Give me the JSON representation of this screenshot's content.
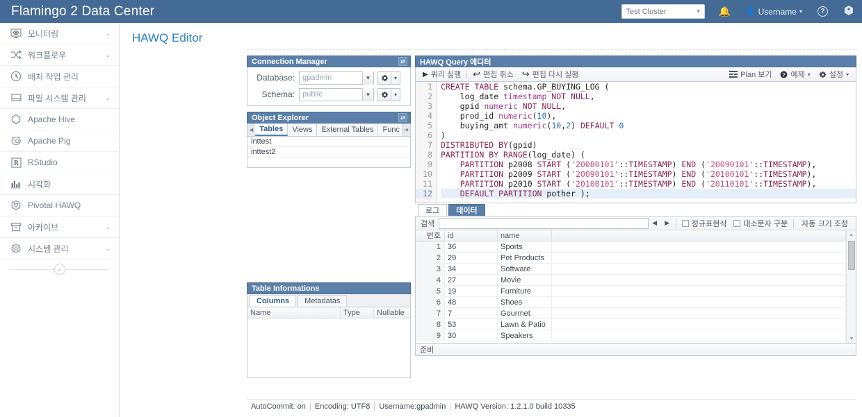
{
  "header": {
    "brand": "Flamingo 2 Data Center",
    "cluster_value": "Test Cluster",
    "notifications_icon": "bell-icon",
    "username": "Username",
    "help_icon": "question-icon",
    "package_icon": "cube-icon"
  },
  "sidebar": {
    "items": [
      {
        "label": "모니터링",
        "icon": "monitor-eye-icon",
        "chevron": "⌄"
      },
      {
        "label": "워크플로우",
        "icon": "workflow-icon",
        "chevron": "⌄"
      },
      {
        "label": "배치 작업 관리",
        "icon": "clock-icon",
        "chevron": ""
      },
      {
        "label": "파일 시스템 관리",
        "icon": "drive-icon",
        "chevron": "⌄"
      },
      {
        "label": "Apache Hive",
        "icon": "hexagon-icon",
        "chevron": ""
      },
      {
        "label": "Apache Pig",
        "icon": "pig-icon",
        "chevron": ""
      },
      {
        "label": "RStudio",
        "icon": "r-box-icon",
        "chevron": ""
      },
      {
        "label": "시각화",
        "icon": "bar-chart-icon",
        "chevron": ""
      },
      {
        "label": "Pivotal HAWQ",
        "icon": "hawq-cube-icon",
        "chevron": ""
      },
      {
        "label": "아카이브",
        "icon": "archive-box-icon",
        "chevron": "⌄"
      },
      {
        "label": "시스템 관리",
        "icon": "gear-icon",
        "chevron": "⌄"
      }
    ],
    "collapse_label": "«"
  },
  "page": {
    "title": "HAWQ Editor"
  },
  "connection_manager": {
    "title": "Connection Manager",
    "restore_icon": "restore-icon",
    "fields": [
      {
        "label": "Database:",
        "value": "gpadmin",
        "gear_icon": "gear-icon",
        "caret": "▾"
      },
      {
        "label": "Schema:",
        "value": "public",
        "gear_icon": "gear-icon",
        "caret": "▾"
      }
    ]
  },
  "object_explorer": {
    "title": "Object Explorer",
    "restore_icon": "restore-icon",
    "scroll_left": "◄",
    "scroll_right": "➜",
    "tabs": [
      {
        "label": "Tables",
        "active": true
      },
      {
        "label": "Views",
        "active": false
      },
      {
        "label": "External Tables",
        "active": false
      },
      {
        "label": "Func",
        "active": false
      }
    ],
    "rows": [
      "inttest",
      "inttest2"
    ]
  },
  "table_informations": {
    "title": "Table Informations",
    "tabs": [
      {
        "label": "Columns",
        "active": true
      },
      {
        "label": "Metadatas",
        "active": false
      }
    ],
    "columns": [
      "Name",
      "Type",
      "Nullable"
    ],
    "rows": []
  },
  "query_editor": {
    "title": "HAWQ Query 에디터",
    "toolbar_left": [
      {
        "label": "쿼리 실행",
        "icon": "play-icon"
      },
      {
        "label": "편집 취소",
        "icon": "undo-arrow-icon"
      },
      {
        "label": "편집 다시 실행",
        "icon": "redo-arrow-icon"
      }
    ],
    "toolbar_right": [
      {
        "label": "Plan 보기",
        "icon": "plan-list-icon",
        "caret": ""
      },
      {
        "label": "예제",
        "icon": "question-circle-icon",
        "caret": "▾"
      },
      {
        "label": "설정",
        "icon": "gear-icon",
        "caret": "▾"
      }
    ],
    "line_numbers": [
      1,
      2,
      3,
      4,
      5,
      6,
      7,
      8,
      9,
      10,
      11,
      12
    ],
    "highlighted_line": 12,
    "code_lines": [
      "CREATE TABLE schema.GP_BUYING_LOG (",
      "    log_date timestamp NOT NULL,",
      "    gpid numeric NOT NULL,",
      "    prod_id numeric(10),",
      "    buying_amt numeric(10,2) DEFAULT 0",
      ")",
      "DISTRIBUTED BY(gpid)",
      "PARTITION BY RANGE(log_date) (",
      "    PARTITION p2008 START ('20080101'::TIMESTAMP) END ('20090101'::TIMESTAMP),",
      "    PARTITION p2009 START ('20090101'::TIMESTAMP) END ('20100101'::TIMESTAMP),",
      "    PARTITION p2010 START ('20100101'::TIMESTAMP) END ('20110101'::TIMESTAMP),",
      "    DEFAULT PARTITION pother );"
    ]
  },
  "results": {
    "tabs": [
      {
        "label": "로그",
        "active": false
      },
      {
        "label": "데이터",
        "active": true
      }
    ],
    "search": {
      "label": "검색",
      "value": "",
      "prev_icon": "◀",
      "next_icon": "▶",
      "options": [
        {
          "label": "정규표현식",
          "checked": false
        },
        {
          "label": "대소문자 구분",
          "checked": false
        }
      ],
      "autosize_label": "자동 크기 조정"
    },
    "columns": [
      "번호",
      "id",
      "name",
      ""
    ],
    "rows": [
      {
        "no": "1",
        "id": "36",
        "name": "Sports"
      },
      {
        "no": "2",
        "id": "29",
        "name": "Pet Products"
      },
      {
        "no": "3",
        "id": "34",
        "name": "Software"
      },
      {
        "no": "4",
        "id": "27",
        "name": "Movie"
      },
      {
        "no": "5",
        "id": "19",
        "name": "Furniture"
      },
      {
        "no": "6",
        "id": "48",
        "name": "Shoes"
      },
      {
        "no": "7",
        "id": "7",
        "name": "Gourmet"
      },
      {
        "no": "8",
        "id": "53",
        "name": "Lawn & Patio"
      },
      {
        "no": "9",
        "id": "30",
        "name": "Speakers"
      }
    ],
    "status": "준비"
  },
  "status_bar": {
    "segments": [
      "AutoCommit: on",
      "Encoding: UTF8",
      "Username:gpadmin",
      "HAWQ Version: 1.2.1.0 build 10335"
    ]
  },
  "colors": {
    "header_blue": "#446B96",
    "panel_blue": "#5A7FA8",
    "title_blue": "#2b7fc4",
    "highlight_line": "#e4eff9"
  }
}
